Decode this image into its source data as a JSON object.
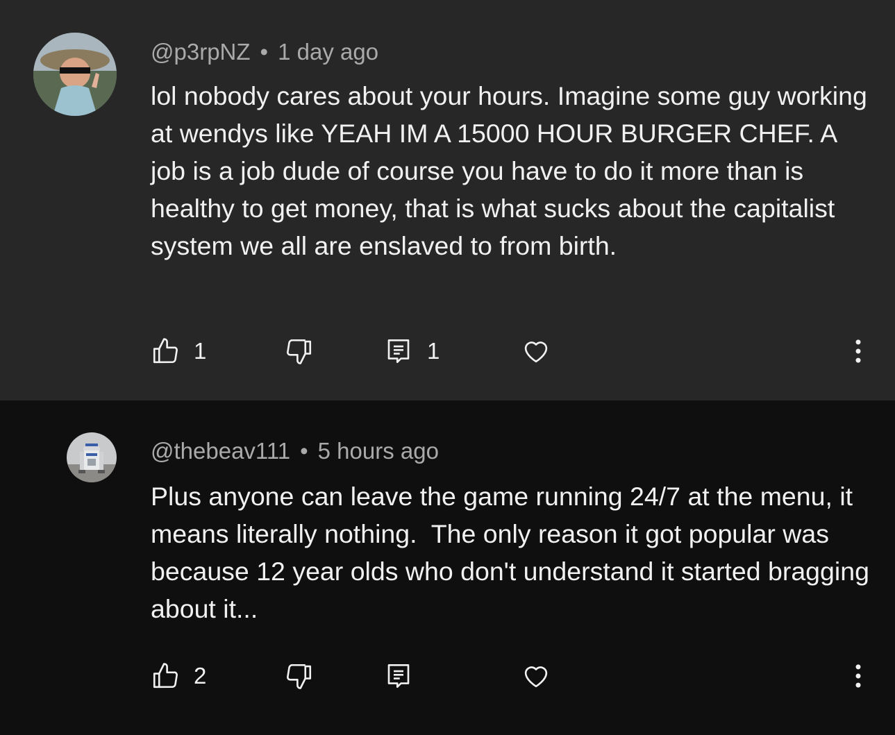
{
  "comments": [
    {
      "handle": "@p3rpNZ",
      "separator": "•",
      "time": "1 day ago",
      "text": "lol nobody cares about your hours. Imagine some guy working at wendys like YEAH IM A 15000 HOUR BURGER CHEF. A job is a job dude of course you have to do it more than is healthy to get money, that is what sucks about the capitalist system we all are enslaved to from birth.",
      "likes": "1",
      "replies": "1",
      "icons": {
        "like": "thumbs-up-icon",
        "dislike": "thumbs-down-icon",
        "reply": "reply-icon",
        "heart": "heart-icon",
        "more": "more-vertical-icon"
      }
    },
    {
      "handle": "@thebeav111",
      "separator": "•",
      "time": "5 hours ago",
      "text": "Plus anyone can leave the game running 24/7 at the menu, it means literally nothing.  The only reason it got popular was because 12 year olds who don't understand it started bragging about it...",
      "likes": "2",
      "replies": "",
      "icons": {
        "like": "thumbs-up-icon",
        "dislike": "thumbs-down-icon",
        "reply": "reply-icon",
        "heart": "heart-icon",
        "more": "more-vertical-icon"
      }
    }
  ],
  "colors": {
    "highlight_bg": "#272727",
    "page_bg": "#0f0f0f",
    "text": "#f1f1f1",
    "meta_text": "#aaaaaa"
  }
}
